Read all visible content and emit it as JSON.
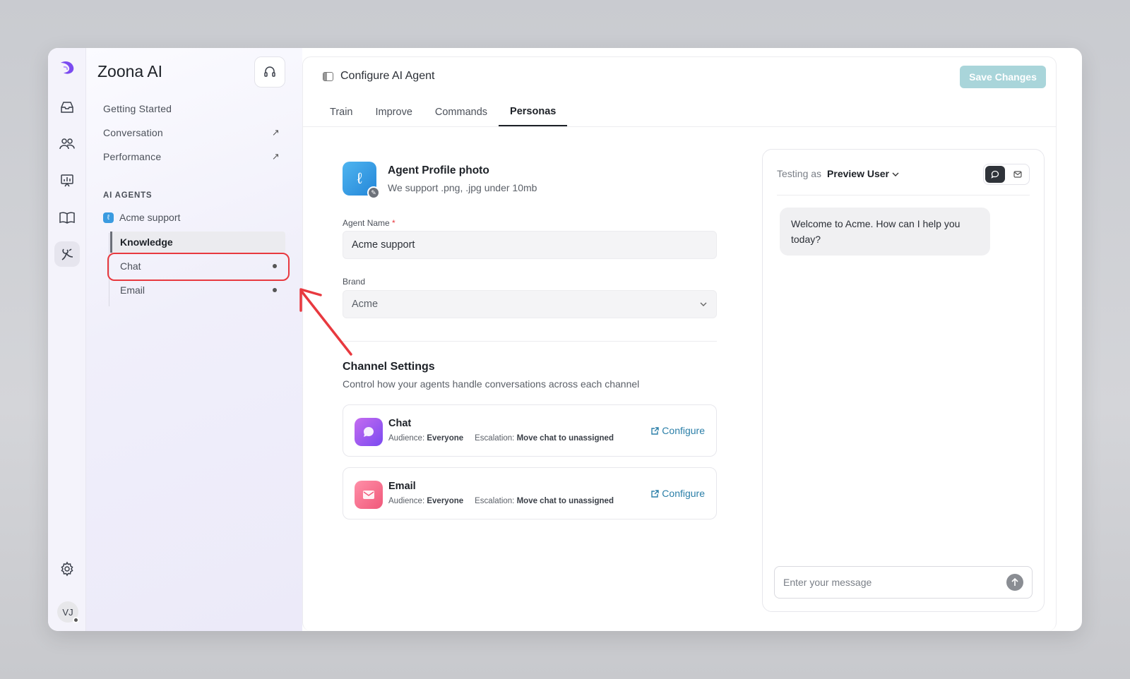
{
  "app": {
    "name": "Zoona AI",
    "user_initials": "VJ"
  },
  "sidebar": {
    "nav": [
      {
        "label": "Getting Started",
        "arrow": ""
      },
      {
        "label": "Conversation",
        "arrow": "↗"
      },
      {
        "label": "Performance",
        "arrow": "↗"
      }
    ],
    "section_label": "AI AGENTS",
    "agent": {
      "badge": "ℓ",
      "name": "Acme support"
    },
    "sub_items": [
      {
        "label": "Knowledge"
      },
      {
        "label": "Chat"
      },
      {
        "label": "Email"
      }
    ]
  },
  "header": {
    "title": "Configure AI Agent",
    "save_label": "Save Changes"
  },
  "tabs": [
    "Train",
    "Improve",
    "Commands",
    "Personas"
  ],
  "active_tab": "Personas",
  "profile": {
    "title": "Agent Profile photo",
    "subtitle": "We support .png, .jpg under 10mb"
  },
  "form": {
    "agent_name_label": "Agent Name",
    "agent_name_required": "*",
    "agent_name_value": "Acme support",
    "brand_label": "Brand",
    "brand_value": "Acme"
  },
  "channel_settings": {
    "title": "Channel Settings",
    "subtitle": "Control how your agents handle conversations across each channel",
    "channels": [
      {
        "name": "Chat",
        "audience_label": "Audience:",
        "audience": "Everyone",
        "escalation_label": "Escalation:",
        "escalation": "Move chat to unassigned",
        "configure": "Configure"
      },
      {
        "name": "Email",
        "audience_label": "Audience:",
        "audience": "Everyone",
        "escalation_label": "Escalation:",
        "escalation": "Move chat to unassigned",
        "configure": "Configure"
      }
    ]
  },
  "preview": {
    "testing_as": "Testing as",
    "user": "Preview User",
    "welcome": "Welcome to Acme. How can I help you today?",
    "input_placeholder": "Enter your message"
  },
  "colors": {
    "accent_teal": "#2b7fa8",
    "save_button": "#a9d5da",
    "highlight_red": "#e8393f"
  }
}
